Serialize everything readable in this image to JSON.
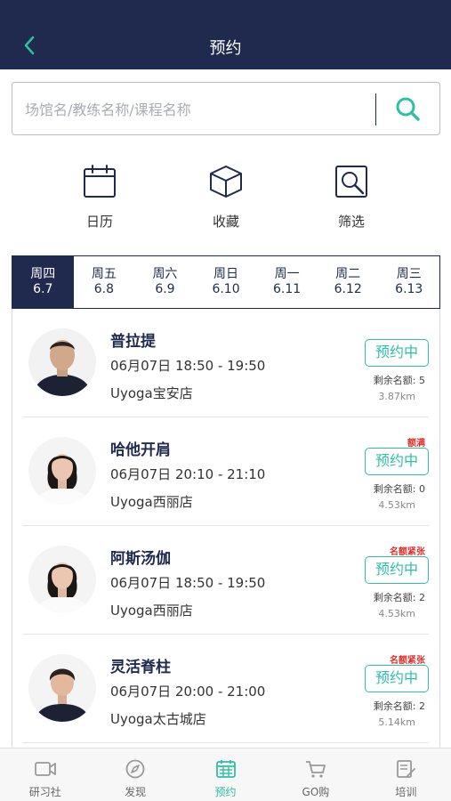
{
  "header": {
    "title": "预约",
    "back_icon": "chevron-left-icon"
  },
  "search": {
    "placeholder": "场馆名/教练名称/课程名称",
    "icon": "search-icon",
    "accent": "#2ebfa5"
  },
  "quick_actions": [
    {
      "label": "日历",
      "icon": "calendar-icon"
    },
    {
      "label": "收藏",
      "icon": "box-icon"
    },
    {
      "label": "筛选",
      "icon": "filter-search-icon"
    }
  ],
  "date_tabs": [
    {
      "weekday": "周四",
      "date": "6.7",
      "active": true
    },
    {
      "weekday": "周五",
      "date": "6.8"
    },
    {
      "weekday": "周六",
      "date": "6.9"
    },
    {
      "weekday": "周日",
      "date": "6.10"
    },
    {
      "weekday": "周一",
      "date": "6.11"
    },
    {
      "weekday": "周二",
      "date": "6.12"
    },
    {
      "weekday": "周三",
      "date": "6.13"
    }
  ],
  "courses": [
    {
      "title": "普拉提",
      "time": "06月07日 18:50 - 19:50",
      "store": "Uyoga宝安店",
      "badge": "",
      "button": "预约中",
      "remaining": "剩余名额: 5",
      "distance": "3.87km"
    },
    {
      "title": "哈他开肩",
      "time": "06月07日 20:10 - 21:10",
      "store": "Uyoga西丽店",
      "badge": "额满",
      "button": "预约中",
      "remaining": "剩余名额: 0",
      "distance": "4.53km"
    },
    {
      "title": "阿斯汤伽",
      "time": "06月07日 18:50 - 19:50",
      "store": "Uyoga西丽店",
      "badge": "名额紧张",
      "button": "预约中",
      "remaining": "剩余名额: 2",
      "distance": "4.53km"
    },
    {
      "title": "灵活脊柱",
      "time": "06月07日 20:00 - 21:00",
      "store": "Uyoga太古城店",
      "badge": "名额紧张",
      "button": "预约中",
      "remaining": "剩余名额: 2",
      "distance": "5.14km"
    }
  ],
  "tabbar": [
    {
      "label": "研习社",
      "icon": "video-camera-icon"
    },
    {
      "label": "发现",
      "icon": "compass-icon"
    },
    {
      "label": "预约",
      "icon": "calendar-grid-icon",
      "active": true
    },
    {
      "label": "GO购",
      "icon": "cart-icon"
    },
    {
      "label": "培训",
      "icon": "document-edit-icon"
    }
  ],
  "colors": {
    "navy": "#1f2a4e",
    "accent": "#2ebfa5",
    "alert": "#e0302c"
  }
}
